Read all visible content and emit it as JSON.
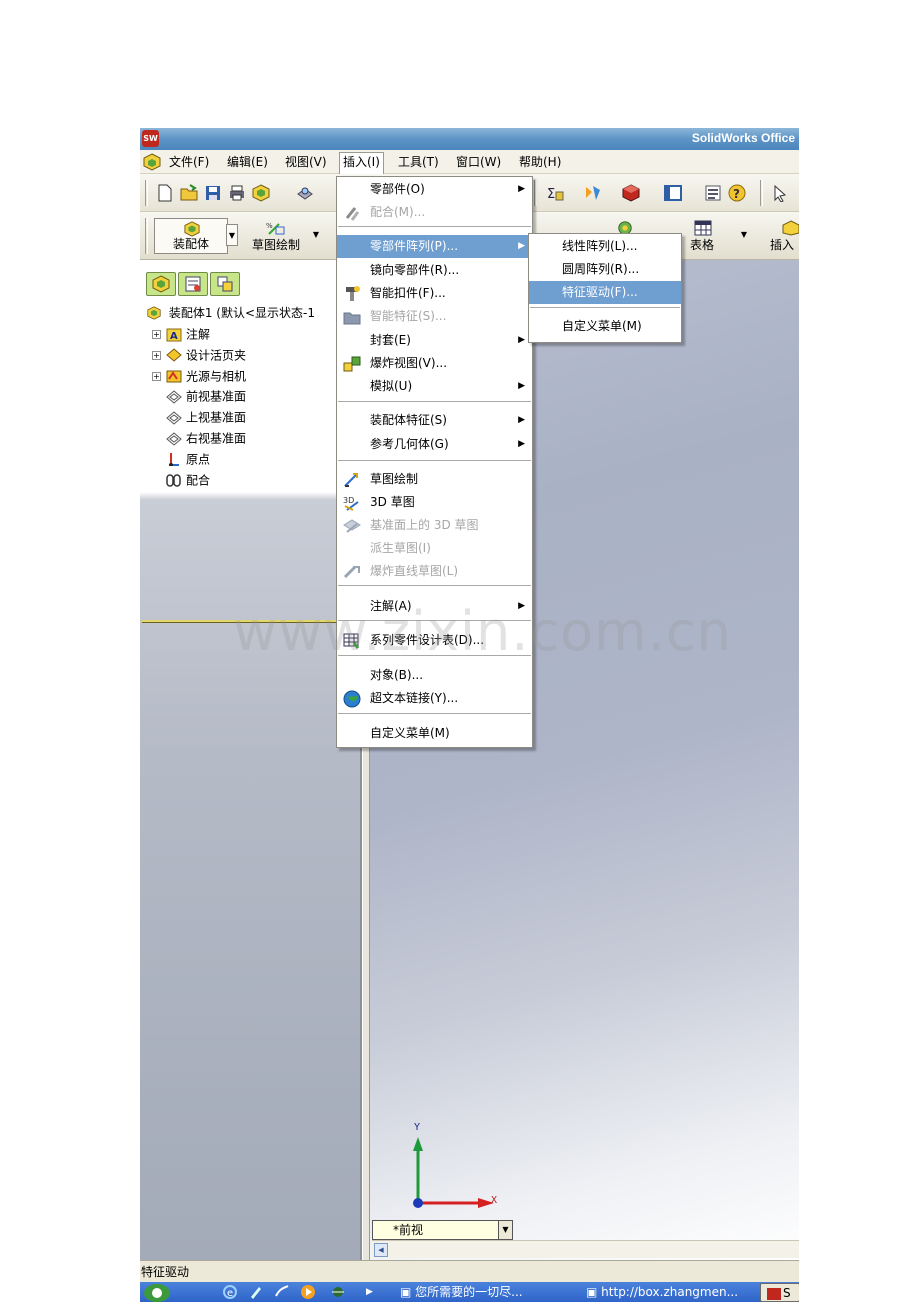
{
  "window": {
    "title": "SolidWorks Office",
    "app_icon_text": "SW"
  },
  "menubar": {
    "items": [
      "文件(F)",
      "编辑(E)",
      "视图(V)",
      "插入(I)",
      "工具(T)",
      "窗口(W)",
      "帮助(H)"
    ],
    "active": "插入(I)"
  },
  "toolbar2": {
    "assembly_label": "装配体",
    "sketch_label": "草图绘制",
    "table_label": "表格",
    "insert_label": "插入"
  },
  "feature_tree": {
    "root": "装配体1 (默认<显示状态-1",
    "items": [
      {
        "label": "注解",
        "icon": "annotation-icon",
        "expandable": true
      },
      {
        "label": "设计活页夹",
        "icon": "design-binder-icon",
        "expandable": true
      },
      {
        "label": "光源与相机",
        "icon": "lights-camera-icon",
        "expandable": true
      },
      {
        "label": "前视基准面",
        "icon": "plane-icon",
        "expandable": false
      },
      {
        "label": "上视基准面",
        "icon": "plane-icon",
        "expandable": false
      },
      {
        "label": "右视基准面",
        "icon": "plane-icon",
        "expandable": false
      },
      {
        "label": "原点",
        "icon": "origin-icon",
        "expandable": false
      },
      {
        "label": "配合",
        "icon": "mates-icon",
        "expandable": false
      }
    ]
  },
  "insert_menu": {
    "items": [
      {
        "label": "零部件(O)",
        "submenu": true,
        "disabled": false,
        "icon": ""
      },
      {
        "label": "配合(M)...",
        "submenu": false,
        "disabled": true,
        "icon": "mate-icon"
      },
      {
        "label": "零部件阵列(P)...",
        "submenu": true,
        "disabled": false,
        "highlight": true,
        "icon": ""
      },
      {
        "label": "镜向零部件(R)...",
        "submenu": false,
        "disabled": false,
        "icon": ""
      },
      {
        "label": "智能扣件(F)...",
        "submenu": false,
        "disabled": false,
        "icon": "smart-fastener-icon"
      },
      {
        "label": "智能特征(S)...",
        "submenu": false,
        "disabled": true,
        "icon": "folder-icon"
      },
      {
        "label": "封套(E)",
        "submenu": true,
        "disabled": false,
        "icon": ""
      },
      {
        "label": "爆炸视图(V)...",
        "submenu": false,
        "disabled": false,
        "icon": "exploded-view-icon"
      },
      {
        "label": "模拟(U)",
        "submenu": true,
        "disabled": false,
        "icon": ""
      },
      {
        "label": "装配体特征(S)",
        "submenu": true,
        "disabled": false,
        "icon": ""
      },
      {
        "label": "参考几何体(G)",
        "submenu": true,
        "disabled": false,
        "icon": ""
      },
      {
        "label": "草图绘制",
        "submenu": false,
        "disabled": false,
        "icon": "sketch-icon"
      },
      {
        "label": "3D 草图",
        "submenu": false,
        "disabled": false,
        "icon": "3d-sketch-icon"
      },
      {
        "label": "基准面上的 3D 草图",
        "submenu": false,
        "disabled": true,
        "icon": "3d-sketch-on-plane-icon"
      },
      {
        "label": "派生草图(I)",
        "submenu": false,
        "disabled": true,
        "icon": ""
      },
      {
        "label": "爆炸直线草图(L)",
        "submenu": false,
        "disabled": true,
        "icon": "explode-line-sketch-icon"
      },
      {
        "label": "注解(A)",
        "submenu": true,
        "disabled": false,
        "icon": ""
      },
      {
        "label": "系列零件设计表(D)...",
        "submenu": false,
        "disabled": false,
        "icon": "design-table-icon"
      },
      {
        "label": "对象(B)...",
        "submenu": false,
        "disabled": false,
        "icon": ""
      },
      {
        "label": "超文本链接(Y)...",
        "submenu": false,
        "disabled": false,
        "icon": "hyperlink-globe-icon"
      },
      {
        "label": "自定义菜单(M)",
        "submenu": false,
        "disabled": false,
        "icon": ""
      }
    ]
  },
  "pattern_submenu": {
    "items": [
      {
        "label": "线性阵列(L)...",
        "highlight": false
      },
      {
        "label": "圆周阵列(R)...",
        "highlight": false
      },
      {
        "label": "特征驱动(F)...",
        "highlight": true
      },
      {
        "label": "自定义菜单(M)",
        "highlight": false
      }
    ]
  },
  "viewport": {
    "view_name": "*前视",
    "axis_y": "Y",
    "axis_x": "X"
  },
  "statusbar": {
    "text": "特征驱动"
  },
  "taskbar": {
    "items": [
      "您所需要的一切尽...",
      "http://box.zhangmen...",
      "S"
    ]
  },
  "watermark": "www.zixin.com.cn",
  "colors": {
    "titlebar": "#5d94c6",
    "menu_highlight": "#6f9ed1",
    "viewport_top": "#a9b1c5",
    "taskbar": "#2f64c9"
  }
}
